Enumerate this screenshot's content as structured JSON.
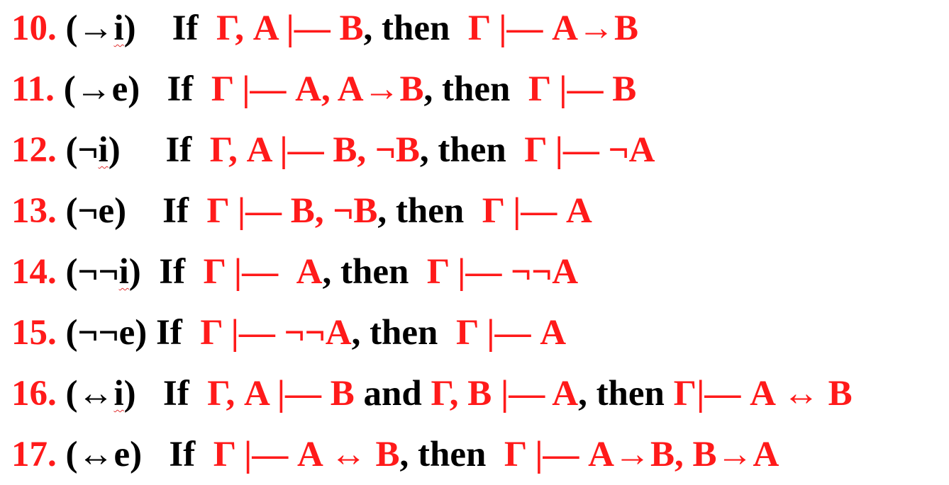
{
  "rules": [
    {
      "number": "10.",
      "name": [
        "(→",
        "i",
        ")"
      ],
      "gap": "    ",
      "parts": [
        {
          "t": "If  ",
          "c": "blk"
        },
        {
          "t": "Γ, A |— B",
          "c": "red"
        },
        {
          "t": ", then  ",
          "c": "blk"
        },
        {
          "t": "Γ |— A→B",
          "c": "red"
        }
      ]
    },
    {
      "number": "11.",
      "name": [
        "(→e)"
      ],
      "gap": "   ",
      "parts": [
        {
          "t": "If  ",
          "c": "blk"
        },
        {
          "t": "Γ |— A, A→B",
          "c": "red"
        },
        {
          "t": ", then  ",
          "c": "blk"
        },
        {
          "t": "Γ |— B",
          "c": "red"
        }
      ]
    },
    {
      "number": "12.",
      "name": [
        "(¬",
        "i",
        ")"
      ],
      "gap": "     ",
      "parts": [
        {
          "t": "If  ",
          "c": "blk"
        },
        {
          "t": "Γ, A |— B, ¬B",
          "c": "red"
        },
        {
          "t": ", then  ",
          "c": "blk"
        },
        {
          "t": "Γ |— ¬A",
          "c": "red"
        }
      ]
    },
    {
      "number": "13.",
      "name": [
        "(¬e)"
      ],
      "gap": "    ",
      "parts": [
        {
          "t": "If  ",
          "c": "blk"
        },
        {
          "t": "Γ |— B, ¬B",
          "c": "red"
        },
        {
          "t": ", then  ",
          "c": "blk"
        },
        {
          "t": "Γ |— A",
          "c": "red"
        }
      ]
    },
    {
      "number": "14.",
      "name": [
        "(¬¬",
        "i",
        ")"
      ],
      "gap": "  ",
      "parts": [
        {
          "t": "If  ",
          "c": "blk"
        },
        {
          "t": "Γ |—  A",
          "c": "red"
        },
        {
          "t": ", then  ",
          "c": "blk"
        },
        {
          "t": "Γ |— ¬¬A",
          "c": "red"
        }
      ]
    },
    {
      "number": "15.",
      "name": [
        "(¬¬e)"
      ],
      "gap": " ",
      "parts": [
        {
          "t": "If  ",
          "c": "blk"
        },
        {
          "t": "Γ |— ¬¬A",
          "c": "red"
        },
        {
          "t": ", then  ",
          "c": "blk"
        },
        {
          "t": "Γ |— A",
          "c": "red"
        }
      ]
    },
    {
      "number": "16.",
      "name": [
        "(↔",
        "i",
        ")"
      ],
      "gap": "   ",
      "parts": [
        {
          "t": "If  ",
          "c": "blk"
        },
        {
          "t": "Γ, A |— B",
          "c": "red"
        },
        {
          "t": " and ",
          "c": "blk"
        },
        {
          "t": "Γ, B |— A",
          "c": "red"
        },
        {
          "t": ", then ",
          "c": "blk"
        },
        {
          "t": "Γ|— A ↔ B",
          "c": "red"
        }
      ]
    },
    {
      "number": "17.",
      "name": [
        "(↔e)"
      ],
      "gap": "   ",
      "parts": [
        {
          "t": "If  ",
          "c": "blk"
        },
        {
          "t": "Γ |— A ↔ B",
          "c": "red"
        },
        {
          "t": ", then  ",
          "c": "blk"
        },
        {
          "t": "Γ |— A→B, B→A",
          "c": "red"
        }
      ]
    }
  ],
  "colors": {
    "accent": "#ff1a1a",
    "text": "#000000",
    "spellcheck": "#e03030"
  }
}
